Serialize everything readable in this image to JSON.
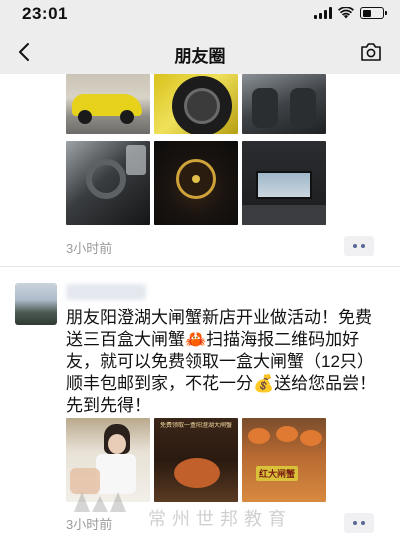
{
  "status_bar": {
    "time": "23:01",
    "icons": [
      "signal-icon",
      "wifi-icon",
      "battery-icon"
    ]
  },
  "nav": {
    "back_icon": "chevron-left-icon",
    "title": "朋友圈",
    "camera_icon": "camera-icon"
  },
  "post1": {
    "time": "3小时前",
    "images": [
      "yellow-sports-car-exterior",
      "yellow-car-wheel",
      "car-seat-interior",
      "car-dashboard-vents",
      "car-instrument-cluster",
      "car-interior-screen"
    ]
  },
  "post2": {
    "text": "朋友阳澄湖大闸蟹新店开业做活动！免费送三百盒大闸蟹🦀扫描海报二维码加好友，就可以免费领取一盒大闸蟹（12只）顺丰包邮到家，不花一分💰送给您品尝！先到先得！",
    "time": "3小时前",
    "images": [
      "woman-with-crab-photo",
      "crab-promo-poster",
      "crab-platter-photo"
    ],
    "poster_caption": "免费领取一盒阳澄湖大闸蟹",
    "platter_caption": "红大闸蟹"
  },
  "watermark": {
    "text": "常州世邦教育"
  },
  "colors": {
    "header_bg": "#ededed",
    "link_blue": "#576b95",
    "time_gray": "#9b9b9b"
  }
}
